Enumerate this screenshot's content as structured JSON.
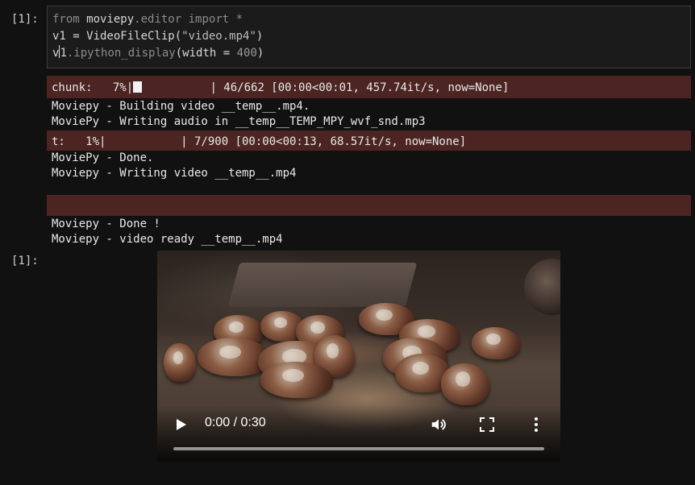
{
  "cell": {
    "input_prompt": "[1]:",
    "output_prompt": "[1]:",
    "code": {
      "line1": {
        "kw1": "from",
        "module": " moviepy",
        "dot_editor": ".editor",
        "kw2": " import",
        "star": " *"
      },
      "line2": {
        "lhs": "v1 = VideoFileClip(",
        "arg": "\"video.mp4\"",
        "close": ")"
      },
      "line3": {
        "a": "v",
        "b": "1",
        "method": ".ipython_display",
        "paren": "(width = ",
        "num": "400",
        "close": ")"
      }
    }
  },
  "output": {
    "chunk_bar": {
      "prefix": "chunk:   7%|",
      "suffix": "          | 46/662 [00:00<00:01, 457.74it/s, now=None]"
    },
    "lines_a": [
      "Moviepy - Building video __temp__.mp4.",
      "MoviePy - Writing audio in __temp__TEMP_MPY_wvf_snd.mp3"
    ],
    "t_bar": {
      "text": "t:   1%|           | 7/900 [00:00<00:13, 68.57it/s, now=None]"
    },
    "lines_b": [
      "MoviePy - Done.",
      "Moviepy - Writing video __temp__.mp4"
    ],
    "lines_c": [
      "Moviepy - Done !",
      "Moviepy - video ready __temp__.mp4"
    ]
  },
  "video_player": {
    "time": "0:00 / 0:30",
    "progress_fraction": 0.0,
    "icons": {
      "play": "play-icon",
      "volume": "volume-icon",
      "fullscreen": "fullscreen-icon",
      "more": "more-options-icon"
    }
  },
  "colors": {
    "background": "#111111",
    "progress_bar_bg": "#4c2522",
    "text": "#e9e9e9"
  }
}
